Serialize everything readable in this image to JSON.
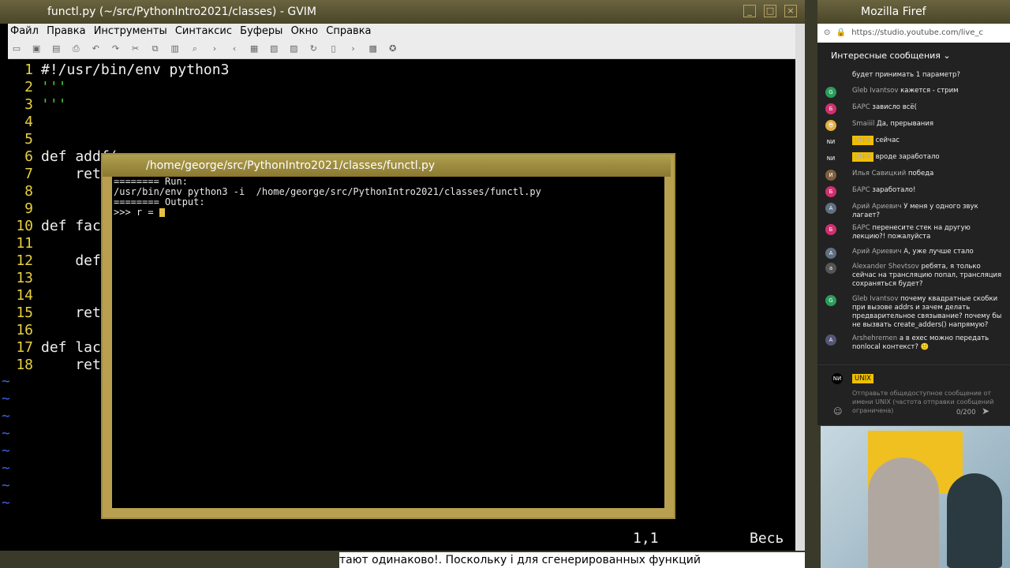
{
  "gvim": {
    "title": "functl.py (~/src/PythonIntro2021/classes) - GVIM",
    "menu": [
      "Файл",
      "Правка",
      "Инструменты",
      "Синтаксис",
      "Буферы",
      "Окно",
      "Справка"
    ],
    "lines": [
      {
        "n": "1",
        "text": "#!/usr/bin/env python3"
      },
      {
        "n": "2",
        "text": "'''"
      },
      {
        "n": "3",
        "text": "'''"
      },
      {
        "n": "4",
        "text": ""
      },
      {
        "n": "5",
        "text": ""
      },
      {
        "n": "6",
        "text": "def addf("
      },
      {
        "n": "7",
        "text": "    ret"
      },
      {
        "n": "8",
        "text": ""
      },
      {
        "n": "9",
        "text": ""
      },
      {
        "n": "10",
        "text": "def fac"
      },
      {
        "n": "11",
        "text": ""
      },
      {
        "n": "12",
        "text": "    def"
      },
      {
        "n": "13",
        "text": ""
      },
      {
        "n": "14",
        "text": ""
      },
      {
        "n": "15",
        "text": "    ret"
      },
      {
        "n": "16",
        "text": ""
      },
      {
        "n": "17",
        "text": "def lac"
      },
      {
        "n": "18",
        "text": "    ret"
      }
    ],
    "position": "1,1",
    "scroll": "Весь"
  },
  "popup": {
    "title": "/home/george/src/PythonIntro2021/classes/functl.py",
    "lines": [
      "======== Run:",
      "/usr/bin/env python3 -i  /home/george/src/PythonIntro2021/classes/functl.py",
      "======== Output:"
    ],
    "prompt": ">>> r = "
  },
  "firefox": {
    "title": "Mozilla Firef",
    "url": "https://studio.youtube.com/live_c",
    "chat_header": "Интересные сообщения",
    "messages": [
      {
        "author": "",
        "text": "будет принимать 1 параметр?",
        "color": "#888"
      },
      {
        "author": "Gleb Ivantsov",
        "text": "кажется - стрим",
        "color": "#2a9d5c",
        "av": "G"
      },
      {
        "author": "БАРС",
        "text": "зависло всё(",
        "color": "#d03070",
        "av": "Б"
      },
      {
        "author": "Smaiiil",
        "text": "Да, прерывания",
        "color": "#e0b040",
        "av": "😎"
      },
      {
        "author": "UNIX",
        "text": "сейчас",
        "color": "#222",
        "av": "NИ",
        "badge": true
      },
      {
        "author": "UNIX",
        "text": "вроде заработало",
        "color": "#222",
        "av": "NИ",
        "badge": true
      },
      {
        "author": "Илья Савицкий",
        "text": "победа",
        "color": "#806040",
        "av": "И"
      },
      {
        "author": "БАРС",
        "text": "заработало!",
        "color": "#d03070",
        "av": "Б"
      },
      {
        "author": "Арий Ариевич",
        "text": "У меня у одного звук лагает?",
        "color": "#607080",
        "av": "A"
      },
      {
        "author": "БАРС",
        "text": "перенесите стек на другую лекцию?! пожалуйста",
        "color": "#d03070",
        "av": "Б"
      },
      {
        "author": "Арий Ариевич",
        "text": "А, уже лучше стало",
        "color": "#607080",
        "av": "A"
      },
      {
        "author": "Alexander Shevtsov",
        "text": "ребята, я только сейчас на трансляцию попал, трансляция сохраняться будет?",
        "color": "#555",
        "av": "a"
      },
      {
        "author": "Gleb Ivantsov",
        "text": "почему квадратные скобки при вызове addrs и зачем делать предварительное связывание? почему бы не вызвать create_adders() напрямую?",
        "color": "#2a9d5c",
        "av": "G"
      },
      {
        "author": "Arshehremen",
        "text": "а в exec можно передать nonlocal контекст? 🙂",
        "color": "#557",
        "av": "A"
      }
    ],
    "input_user": "UNIX",
    "input_placeholder": "Отправьте общедоступное сообщение от имени UNIX (частота отправки сообщений ограничена)",
    "counter": "0/200"
  },
  "subtitle": "тают одинаково!. Поскольку i для сгенерированных функций"
}
